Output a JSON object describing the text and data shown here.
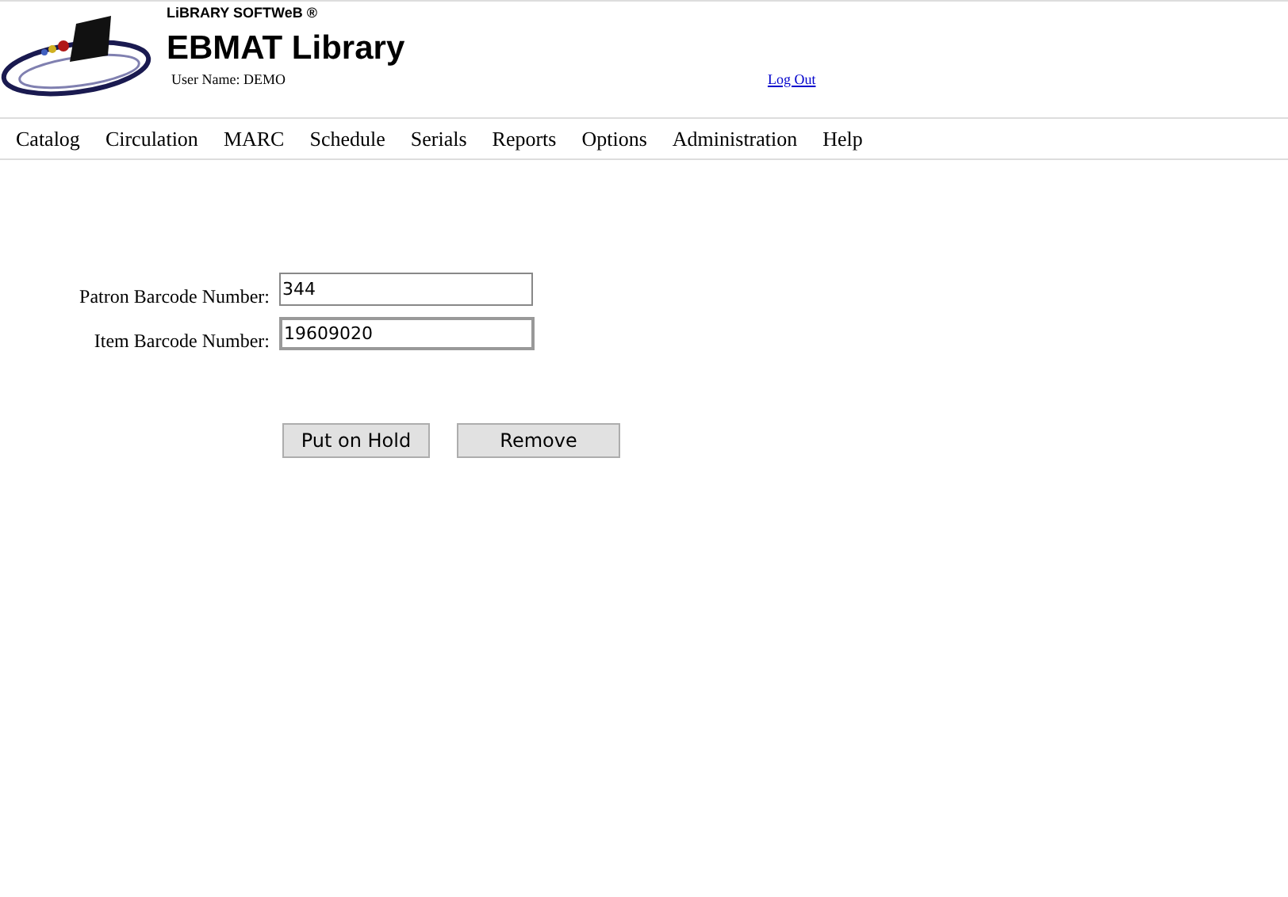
{
  "header": {
    "brand": "LiBRARY SOFTWeB ®",
    "title": "EBMAT Library",
    "user_name": "User Name: DEMO",
    "logout": "Log Out"
  },
  "menu": [
    {
      "label": "Catalog"
    },
    {
      "label": "Circulation"
    },
    {
      "label": "MARC"
    },
    {
      "label": "Schedule"
    },
    {
      "label": "Serials"
    },
    {
      "label": "Reports"
    },
    {
      "label": "Options"
    },
    {
      "label": "Administration"
    },
    {
      "label": "Help"
    }
  ],
  "form": {
    "fields": [
      {
        "label": "Patron Barcode Number:",
        "value": "344",
        "focused": false
      },
      {
        "label": "Item Barcode Number:",
        "value": "19609020",
        "focused": true
      }
    ],
    "buttons": [
      "Put on Hold",
      "Remove"
    ]
  }
}
